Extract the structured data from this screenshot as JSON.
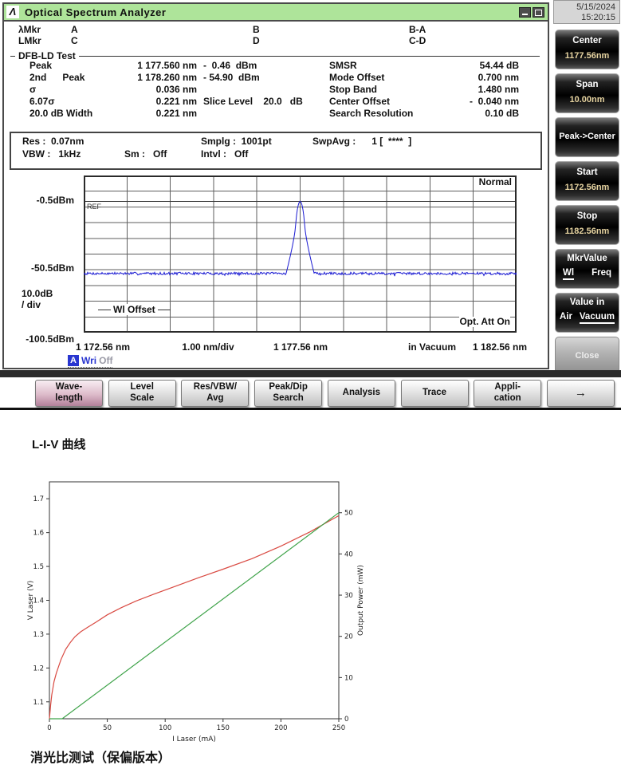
{
  "header": {
    "date": "5/15/2024",
    "time": "15:20:15"
  },
  "window": {
    "title": "Optical Spectrum Analyzer",
    "markers": {
      "rows": [
        {
          "label": "λMkr",
          "c1": "A",
          "c2": "B",
          "c3": "B-A"
        },
        {
          "label": "LMkr",
          "c1": "C",
          "c2": "D",
          "c3": "C-D"
        }
      ]
    },
    "analysis_title": "DFB-LD Test",
    "results_left": [
      {
        "name": "Peak",
        "wl": "1 177.560 nm",
        "extra": "-  0.46  dBm"
      },
      {
        "name": "2nd      Peak",
        "wl": "1 178.260 nm",
        "extra": "- 54.90  dBm"
      },
      {
        "name": "σ",
        "wl": "0.036 nm",
        "extra": ""
      },
      {
        "name": "6.07σ",
        "wl": "0.221 nm",
        "extra": "Slice Level    20.0   dB"
      },
      {
        "name": "20.0 dB Width",
        "wl": "0.221 nm",
        "extra": ""
      }
    ],
    "results_right": [
      {
        "name": "SMSR",
        "value": "54.44 dB"
      },
      {
        "name": "Mode Offset",
        "value": "0.700 nm"
      },
      {
        "name": "Stop Band",
        "value": "1.480 nm"
      },
      {
        "name": "Center Offset",
        "value": "-  0.040 nm"
      },
      {
        "name": "Search Resolution",
        "value": "0.10 dB"
      }
    ],
    "settings": {
      "row1": [
        "Res :  0.07nm",
        "Smplg :  1001pt",
        "SwpAvg :      1 [  ****  ]"
      ],
      "row2": [
        "VBW :   1kHz",
        "Sm :   Off",
        "Intvl :   Off"
      ]
    },
    "graph": {
      "display_mode": "Normal",
      "ref_label": "REF",
      "y_axis": {
        "ref": "-0.5dBm",
        "mid": "-50.5dBm",
        "scale_line1": "10.0dB",
        "scale_line2": "/ div",
        "bottom": "-100.5dBm"
      },
      "overlays": {
        "wl_offset": "Wl Offset",
        "opt_att": "Opt. Att On"
      },
      "x_axis": {
        "start": "1 172.56 nm",
        "div": "1.00 nm/div",
        "center": "1 177.56 nm",
        "medium": "in Vacuum",
        "stop": "1 182.56 nm"
      },
      "trace_info": {
        "trace": "A",
        "write": "Wri",
        "state": "Off"
      }
    }
  },
  "sidebar": {
    "buttons": [
      {
        "label": "Center",
        "value": "1177.56nm"
      },
      {
        "label": "Span",
        "value": "10.00nm"
      },
      {
        "label": "Peak->Center",
        "value": ""
      },
      {
        "label": "Start",
        "value": "1172.56nm"
      },
      {
        "label": "Stop",
        "value": "1182.56nm"
      },
      {
        "label": "MkrValue",
        "opt1": "Wl",
        "opt2": "Freq",
        "selected": "Wl"
      },
      {
        "label": "Value in",
        "opt1": "Air",
        "opt2": "Vacuum",
        "selected": "Vacuum"
      },
      {
        "label": "Close",
        "value": ""
      }
    ]
  },
  "menu": {
    "items": [
      {
        "line1": "Wave-",
        "line2": "length",
        "active": true
      },
      {
        "line1": "Level",
        "line2": "Scale",
        "active": false
      },
      {
        "line1": "Res/VBW/",
        "line2": "Avg",
        "active": false
      },
      {
        "line1": "Peak/Dip",
        "line2": "Search",
        "active": false
      },
      {
        "line1": "Analysis",
        "line2": "",
        "active": false
      },
      {
        "line1": "Trace",
        "line2": "",
        "active": false
      },
      {
        "line1": "Appli-",
        "line2": "cation",
        "active": false
      },
      {
        "line1": "→",
        "line2": "",
        "active": false
      }
    ]
  },
  "sections": {
    "liv_heading": "L-I-V 曲线",
    "er_heading": "消光比测试（保偏版本）"
  },
  "chart_data": [
    {
      "id": "osa-spectrum",
      "type": "line",
      "x_range": [
        1172.56,
        1182.56
      ],
      "x_div_nm": 1.0,
      "ref_dbm": -0.5,
      "db_per_div": 10.0,
      "y_bottom_dbm": -100.5,
      "grid_divs": [
        10,
        10
      ],
      "peak": {
        "wavelength_nm": 1177.56,
        "level_dbm": -0.46
      },
      "second_peak": {
        "wavelength_nm": 1178.26,
        "level_dbm": -54.9
      },
      "noise_floor_dbm": -55.4,
      "smsr_db": 54.44,
      "trace_color": "#1a1ad2"
    },
    {
      "id": "liv-curve",
      "type": "line",
      "xlabel": "I Laser (mA)",
      "ylabel_left": "V Laser (V)",
      "ylabel_right": "Output Power (mW)",
      "xlim": [
        0,
        250
      ],
      "xticks": [
        0,
        50,
        100,
        150,
        200,
        250
      ],
      "ylim_left": [
        1.05,
        1.75
      ],
      "yticks_left": [
        1.1,
        1.2,
        1.3,
        1.4,
        1.5,
        1.6,
        1.7
      ],
      "ylim_right": [
        0,
        57.5
      ],
      "yticks_right": [
        0,
        10,
        20,
        30,
        40,
        50
      ],
      "series": [
        {
          "name": "V Laser",
          "axis": "left",
          "color": "#d94a42",
          "points": [
            [
              0,
              1.05
            ],
            [
              1,
              1.09
            ],
            [
              2,
              1.12
            ],
            [
              4,
              1.16
            ],
            [
              6,
              1.185
            ],
            [
              8,
              1.205
            ],
            [
              10,
              1.225
            ],
            [
              14,
              1.255
            ],
            [
              18,
              1.275
            ],
            [
              22,
              1.292
            ],
            [
              27,
              1.307
            ],
            [
              33,
              1.32
            ],
            [
              40,
              1.335
            ],
            [
              50,
              1.357
            ],
            [
              62,
              1.378
            ],
            [
              75,
              1.398
            ],
            [
              90,
              1.418
            ],
            [
              110,
              1.443
            ],
            [
              130,
              1.468
            ],
            [
              150,
              1.492
            ],
            [
              175,
              1.523
            ],
            [
              200,
              1.56
            ],
            [
              225,
              1.602
            ],
            [
              250,
              1.65
            ]
          ]
        },
        {
          "name": "Output Power",
          "axis": "right",
          "color": "#3fa34a",
          "points": [
            [
              0,
              0
            ],
            [
              11,
              0
            ],
            [
              250,
              50
            ]
          ]
        }
      ]
    }
  ]
}
